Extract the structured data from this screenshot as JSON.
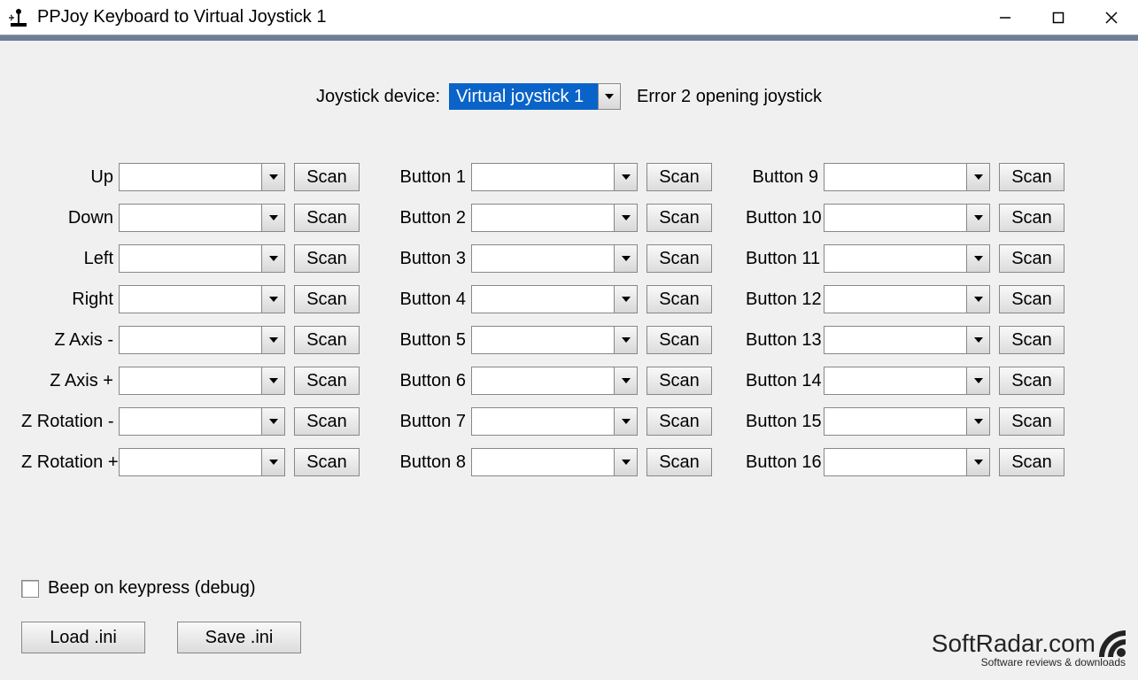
{
  "window": {
    "title": "PPJoy Keyboard to Virtual Joystick 1"
  },
  "header": {
    "device_label": "Joystick device:",
    "device_value": "Virtual joystick 1",
    "error_text": "Error 2 opening joystick"
  },
  "scan_label": "Scan",
  "columns": {
    "col1": [
      {
        "label": "Up",
        "value": ""
      },
      {
        "label": "Down",
        "value": ""
      },
      {
        "label": "Left",
        "value": ""
      },
      {
        "label": "Right",
        "value": ""
      },
      {
        "label": "Z Axis -",
        "value": ""
      },
      {
        "label": "Z Axis +",
        "value": ""
      },
      {
        "label": "Z Rotation -",
        "value": ""
      },
      {
        "label": "Z Rotation +",
        "value": ""
      }
    ],
    "col2": [
      {
        "label": "Button 1",
        "value": ""
      },
      {
        "label": "Button 2",
        "value": ""
      },
      {
        "label": "Button 3",
        "value": ""
      },
      {
        "label": "Button 4",
        "value": ""
      },
      {
        "label": "Button 5",
        "value": ""
      },
      {
        "label": "Button 6",
        "value": ""
      },
      {
        "label": "Button 7",
        "value": ""
      },
      {
        "label": "Button 8",
        "value": ""
      }
    ],
    "col3": [
      {
        "label": "Button 9",
        "value": ""
      },
      {
        "label": "Button 10",
        "value": ""
      },
      {
        "label": "Button 11",
        "value": ""
      },
      {
        "label": "Button 12",
        "value": ""
      },
      {
        "label": "Button 13",
        "value": ""
      },
      {
        "label": "Button 14",
        "value": ""
      },
      {
        "label": "Button 15",
        "value": ""
      },
      {
        "label": "Button 16",
        "value": ""
      }
    ]
  },
  "beep": {
    "label": "Beep on keypress (debug)",
    "checked": false
  },
  "buttons": {
    "load": "Load .ini",
    "save": "Save .ini"
  },
  "watermark": {
    "main": "SoftRadar.com",
    "sub": "Software reviews & downloads"
  }
}
